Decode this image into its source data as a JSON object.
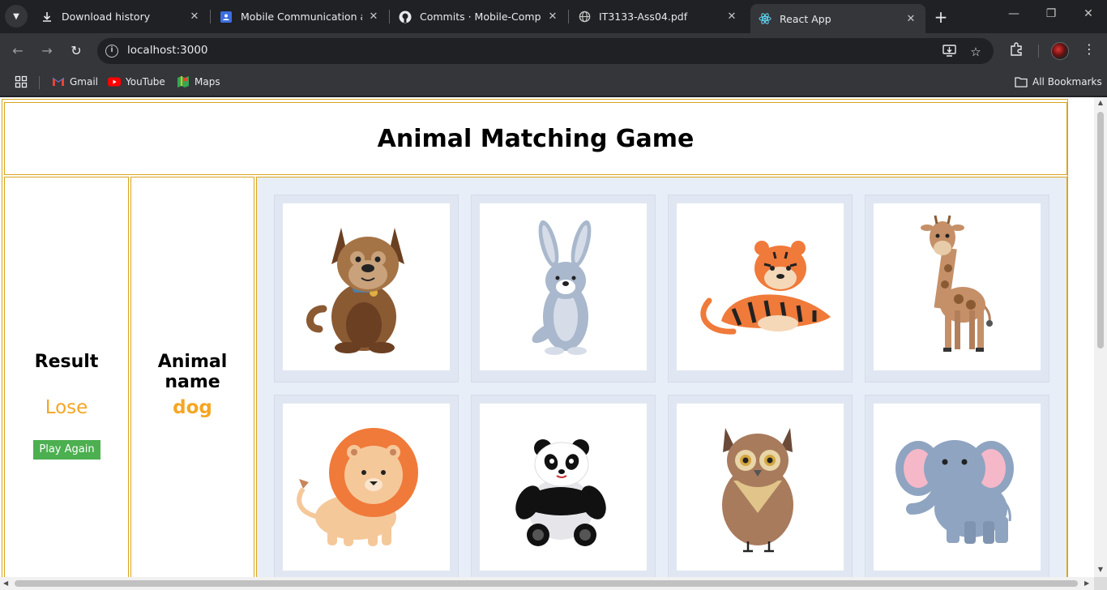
{
  "browser": {
    "tabs": [
      {
        "title": "Download history",
        "icon": "download-icon"
      },
      {
        "title": "Mobile Communication and",
        "icon": "google-docs-icon"
      },
      {
        "title": "Commits · Mobile-Computin",
        "icon": "github-icon"
      },
      {
        "title": "IT3133-Ass04.pdf",
        "icon": "globe-icon"
      },
      {
        "title": "React App",
        "icon": "react-icon",
        "active": true
      }
    ],
    "url": "localhost:3000",
    "bookmarks": [
      {
        "label": "Gmail",
        "icon": "gmail-icon"
      },
      {
        "label": "YouTube",
        "icon": "youtube-icon"
      },
      {
        "label": "Maps",
        "icon": "maps-icon"
      }
    ],
    "all_bookmarks": "All Bookmarks"
  },
  "game": {
    "title": "Animal Matching Game",
    "result_label": "Result",
    "result_value": "Lose",
    "animal_label": "Animal name",
    "animal_value": "dog",
    "play_again": "Play Again",
    "animals": [
      "dog",
      "rabbit",
      "tiger",
      "giraffe",
      "lion",
      "panda",
      "owl",
      "elephant"
    ]
  },
  "colors": {
    "accent_orange": "#f5a623",
    "border_gold": "#d9a520",
    "button_green": "#4caf50",
    "grid_bg": "#e8eef8"
  }
}
